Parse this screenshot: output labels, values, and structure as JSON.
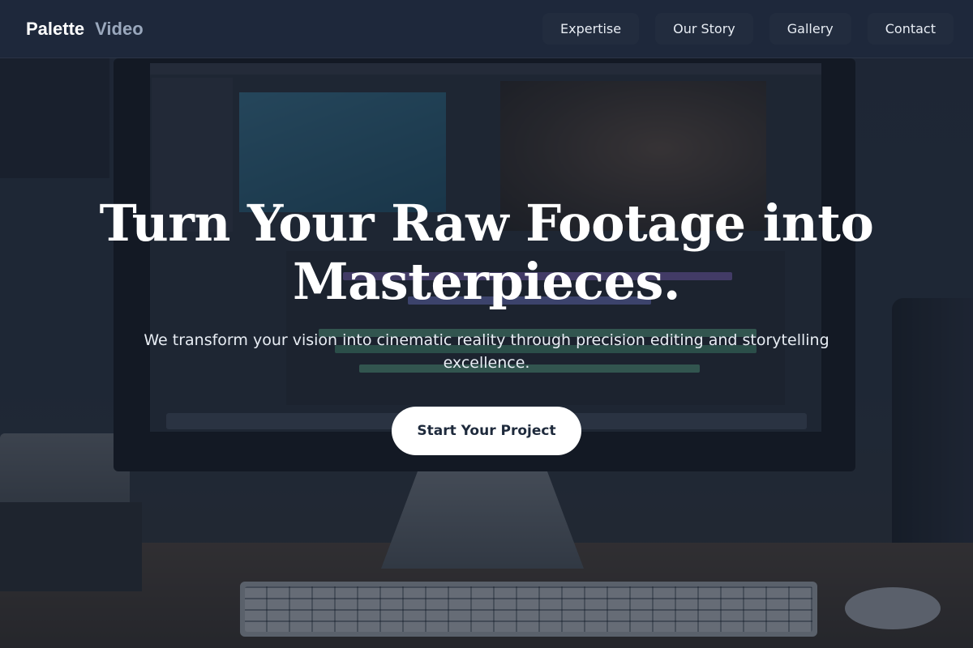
{
  "brand": {
    "primary": "Palette",
    "secondary": "Video"
  },
  "nav": {
    "items": [
      {
        "label": "Expertise"
      },
      {
        "label": "Our Story"
      },
      {
        "label": "Gallery"
      },
      {
        "label": "Contact"
      }
    ]
  },
  "hero": {
    "title": "Turn Your Raw Footage into Masterpieces.",
    "subtitle": "We transform your vision into cinematic reality through precision editing and storytelling excellence.",
    "cta_label": "Start Your Project"
  },
  "colors": {
    "header_bg": "#1e283c",
    "brand_secondary": "#9aa8bd",
    "cta_bg": "#ffffff",
    "cta_text": "#1e2a3c"
  }
}
